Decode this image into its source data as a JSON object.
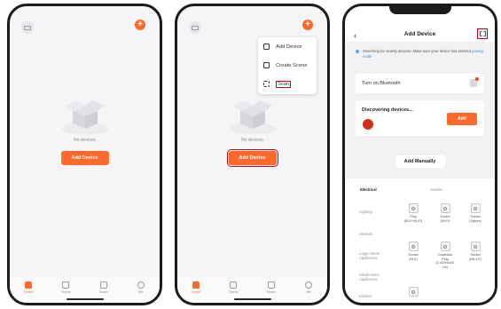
{
  "phone1": {
    "empty_text": "No devices",
    "add_button": "Add Device",
    "nav": [
      "Home",
      "Scene",
      "Smart",
      "Me"
    ]
  },
  "phone2": {
    "empty_text": "No devices",
    "add_button": "Add Device",
    "menu": [
      "Add Device",
      "Create Scene",
      "Scan"
    ],
    "nav": [
      "Home",
      "Scene",
      "Smart",
      "Me"
    ]
  },
  "phone3": {
    "title": "Add Device",
    "info_text": "Searching for nearby devices. Make sure your device has entered",
    "info_link": "pairing mode",
    "bluetooth_label": "Turn on Bluetooth",
    "discovering_label": "Discovering devices...",
    "discover_add_button": "Add",
    "add_manually": "Add Manually",
    "categories": [
      "Electrical",
      "Lighting",
      "Sensors",
      "Large Home Appliances",
      "Small Home Appliances",
      "Kitchen"
    ],
    "grid_header": "Socket",
    "devices": [
      [
        "Plug",
        "(BLE+Wi-Fi)"
      ],
      [
        "Socket",
        "(Wi-Fi)"
      ],
      [
        "Socket",
        "(Zigbee)"
      ],
      [
        "Socket",
        "(BLE)"
      ],
      [
        "Dualband",
        "Plug",
        "(2.4GHz&5G",
        "Hz)"
      ],
      [
        "Socket",
        "(NB-IoT)"
      ]
    ]
  },
  "colors": {
    "accent": "#ff6a2a",
    "highlight_box": "#d0021b",
    "link": "#3a8fd9"
  }
}
